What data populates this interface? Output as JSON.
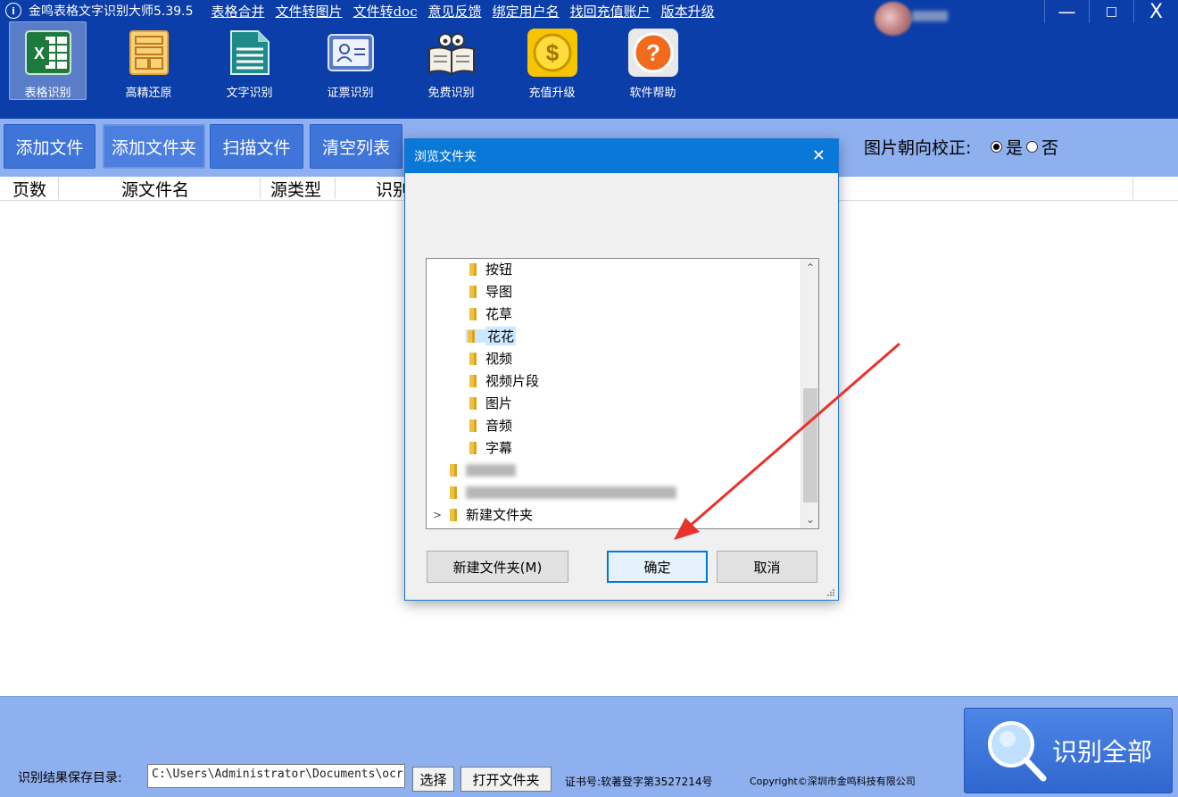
{
  "app": {
    "logo_glyph": "i",
    "title": "金鸣表格文字识别大师5.39.5",
    "menu_links": [
      "表格合并",
      "文件转图片",
      "文件转doc",
      "意见反馈",
      "绑定用户名",
      "找回充值账户",
      "版本升级"
    ]
  },
  "window_controls": {
    "minimize": "—",
    "maximize": "□",
    "close": "X"
  },
  "toolbar": {
    "items": [
      {
        "label": "表格识别",
        "icon": "excel-icon",
        "active": true
      },
      {
        "label": "高精还原",
        "icon": "layout-icon",
        "active": false
      },
      {
        "label": "文字识别",
        "icon": "document-icon",
        "active": false
      },
      {
        "label": "证票识别",
        "icon": "id-card-icon",
        "active": false
      },
      {
        "label": "免费识别",
        "icon": "book-icon",
        "active": false
      },
      {
        "label": "充值升级",
        "icon": "coin-icon",
        "active": false
      },
      {
        "label": "软件帮助",
        "icon": "help-icon",
        "active": false
      }
    ]
  },
  "actions": {
    "add_file": "添加文件",
    "add_folder": "添加文件夹",
    "scan_file": "扫描文件",
    "clear_list": "清空列表",
    "orientation_label": "图片朝向校正:",
    "orientation_yes": "是",
    "orientation_no": "否",
    "orientation_selected": "是"
  },
  "table": {
    "columns": [
      "页数",
      "源文件名",
      "源类型",
      "识别"
    ]
  },
  "footer": {
    "save_dir_label": "识别结果保存目录:",
    "save_dir_value": "C:\\Users\\Administrator\\Documents\\ocr",
    "choose_button": "选择",
    "open_folder_button": "打开文件夹",
    "cert_text": "证书号:软著登字第3527214号",
    "copyright_text": "Copyright©深圳市金鸣科技有限公司",
    "recognize_all": "识别全部"
  },
  "dialog": {
    "title": "浏览文件夹",
    "close_glyph": "✕",
    "tree": [
      {
        "label": "按钮",
        "level": 2
      },
      {
        "label": "导图",
        "level": 2
      },
      {
        "label": "花草",
        "level": 2
      },
      {
        "label": "花花",
        "level": 2,
        "selected": true
      },
      {
        "label": "视频",
        "level": 2
      },
      {
        "label": "视频片段",
        "level": 2
      },
      {
        "label": "图片",
        "level": 2
      },
      {
        "label": "音频",
        "level": 2
      },
      {
        "label": "字幕",
        "level": 2
      },
      {
        "label": "新建文件夹",
        "level": 1,
        "expandable": true
      }
    ],
    "new_folder_button": "新建文件夹(M)",
    "ok_button": "确定",
    "cancel_button": "取消"
  },
  "colors": {
    "header_bg": "#0b3ea8",
    "action_bar_bg": "#8fb0ef",
    "button_blue": "#3f74d9",
    "dialog_title_bg": "#0a78d7",
    "arrow_red": "#e8322c"
  }
}
